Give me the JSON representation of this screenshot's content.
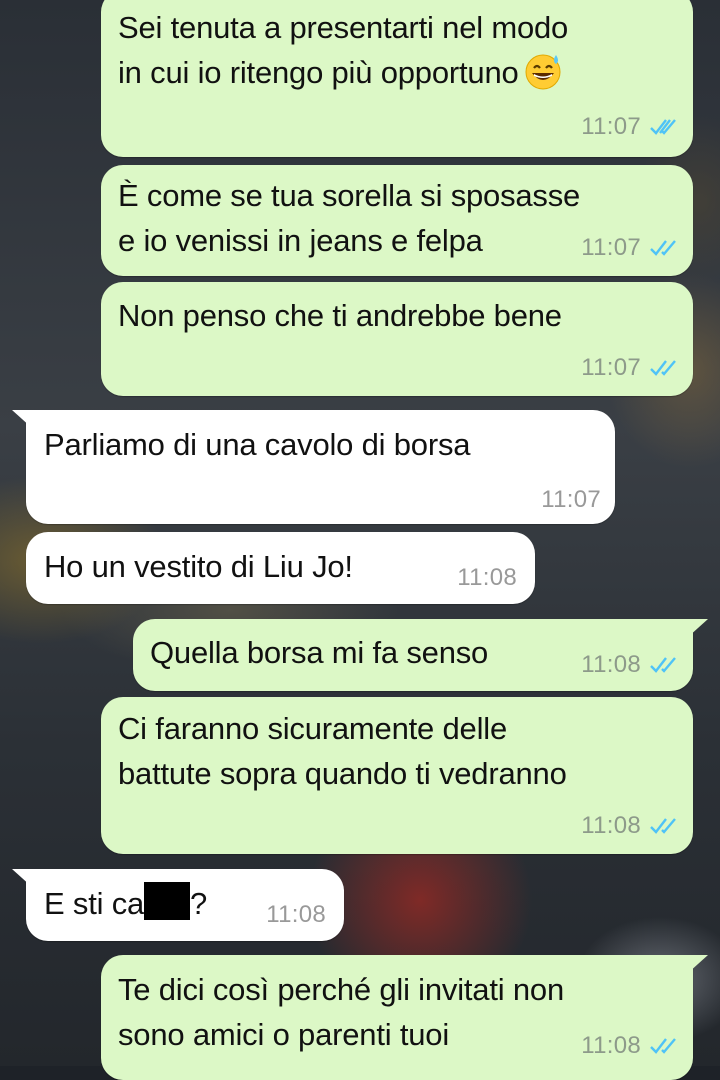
{
  "chat": {
    "tick_color": "#4fc3f7",
    "messages": [
      {
        "dir": "out",
        "text_lines": [
          "Sei tenuta a presentarti nel modo",
          "in cui io ritengo più opportuno"
        ],
        "emoji": "grinning-sweat-icon",
        "time": "11:07",
        "status": "read"
      },
      {
        "dir": "out",
        "text_lines": [
          "È come se tua sorella si sposasse",
          "e io venissi in jeans e felpa"
        ],
        "time": "11:07",
        "status": "read"
      },
      {
        "dir": "out",
        "text_lines": [
          "Non penso che ti andrebbe bene"
        ],
        "time": "11:07",
        "status": "read"
      },
      {
        "dir": "in",
        "text_lines": [
          "Parliamo di una cavolo di borsa"
        ],
        "time": "11:07"
      },
      {
        "dir": "in",
        "text_lines": [
          "Ho un vestito di Liu Jo!"
        ],
        "time": "11:08"
      },
      {
        "dir": "out",
        "text_lines": [
          "Quella borsa mi fa senso"
        ],
        "time": "11:08",
        "status": "read"
      },
      {
        "dir": "out",
        "text_lines": [
          "Ci faranno sicuramente delle",
          "battute sopra quando ti vedranno"
        ],
        "time": "11:08",
        "status": "read"
      },
      {
        "dir": "in",
        "text_prefix": "E sti ca",
        "text_suffix": "?",
        "redacted": true,
        "time": "11:08"
      },
      {
        "dir": "out",
        "text_lines": [
          "Te dici così perché gli invitati non",
          "sono amici o parenti tuoi"
        ],
        "time": "11:08",
        "status": "read"
      }
    ]
  }
}
